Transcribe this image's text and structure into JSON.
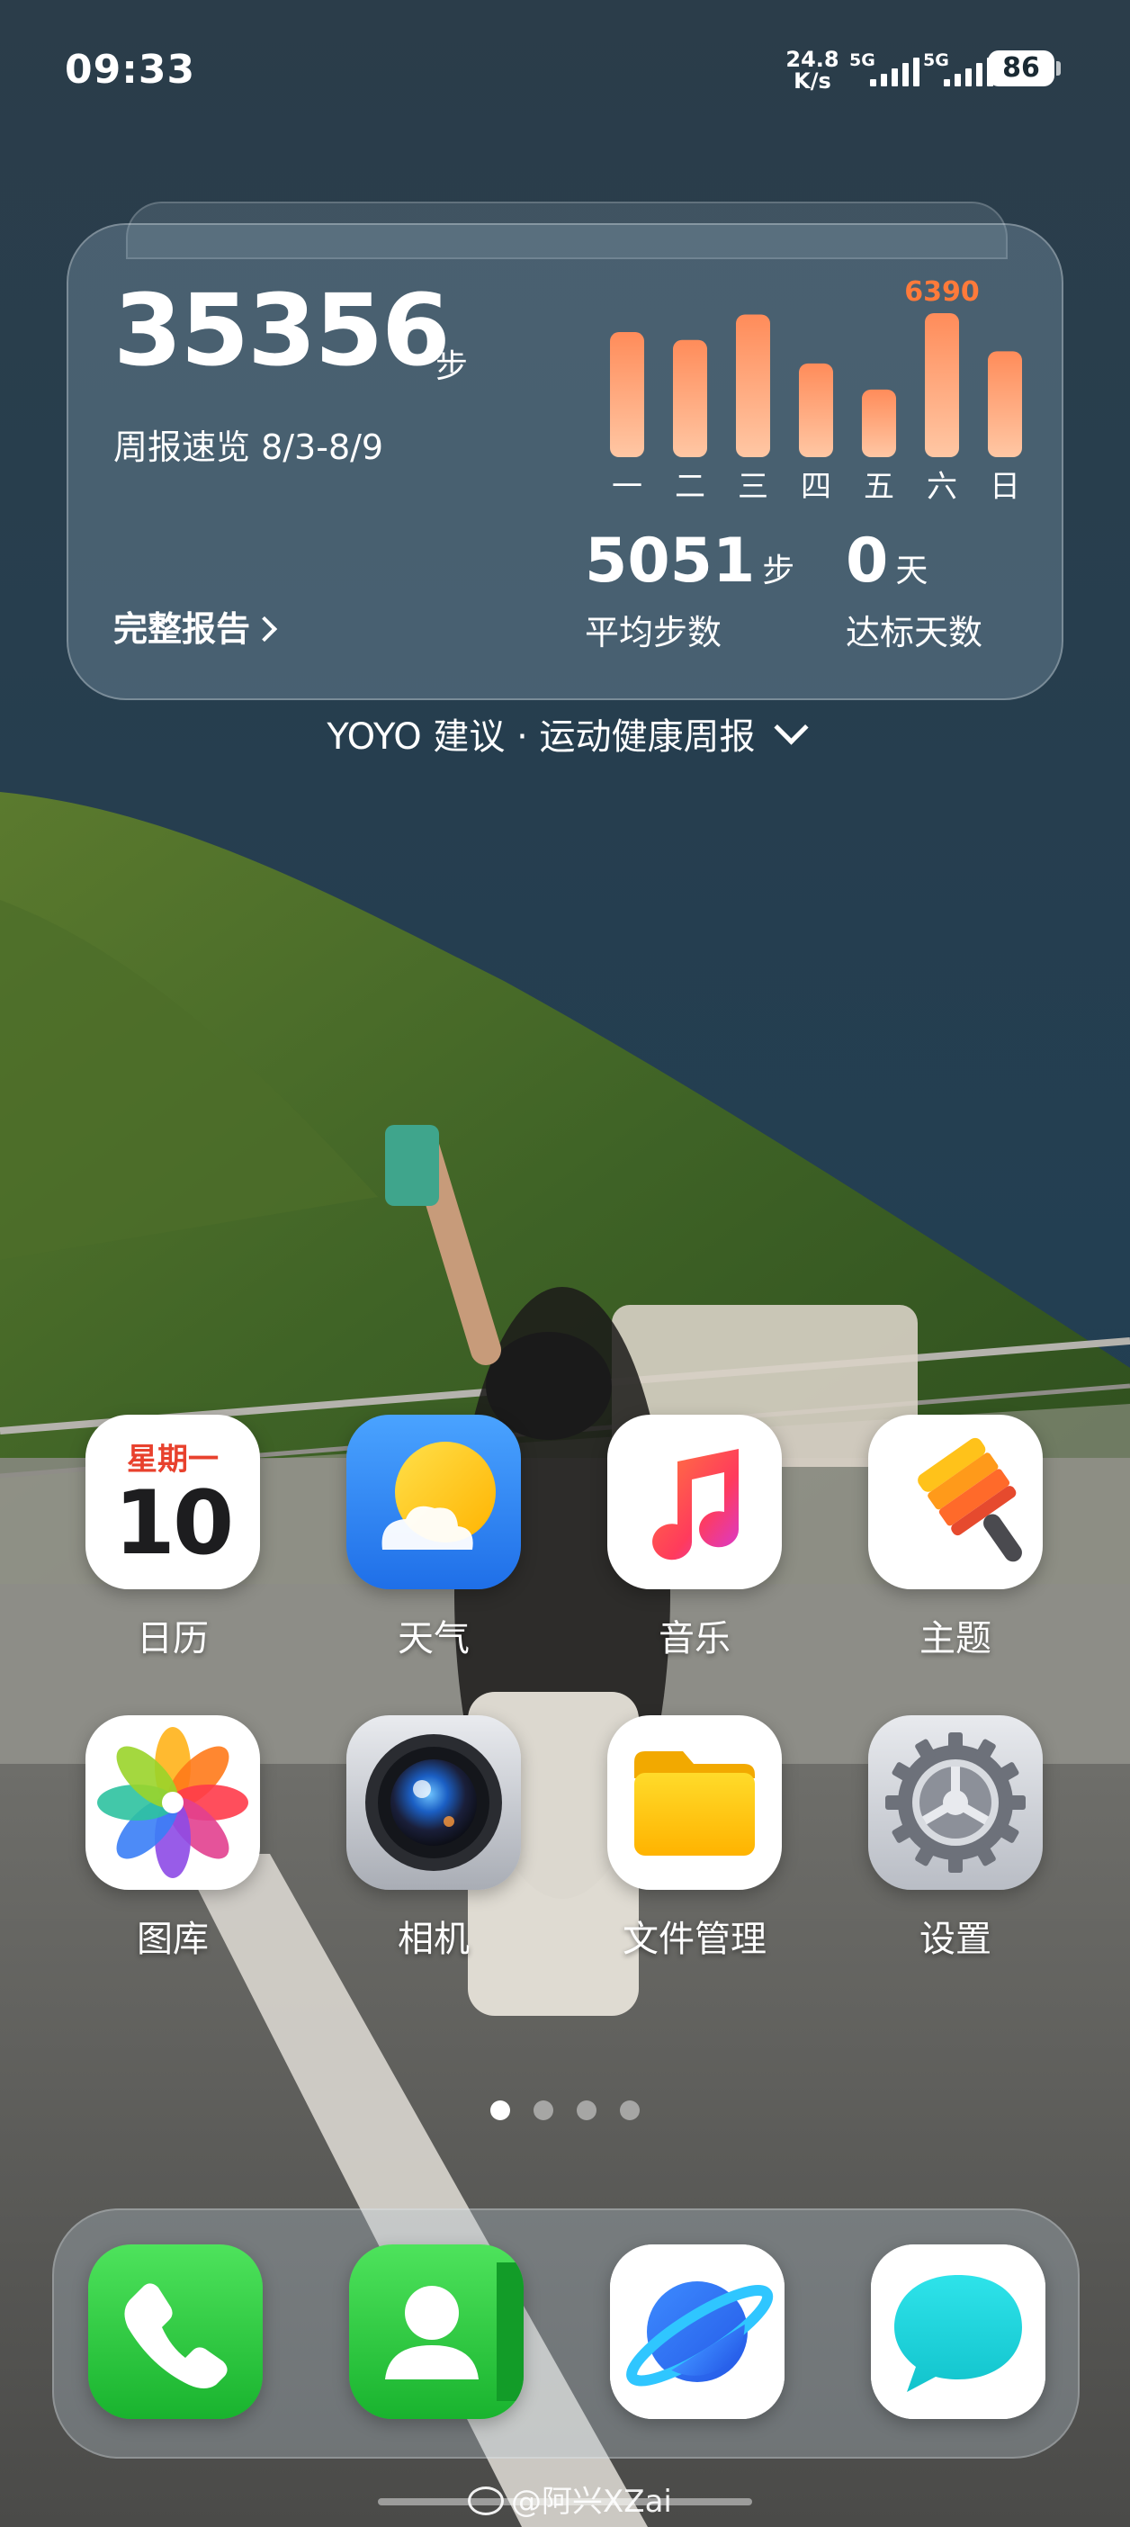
{
  "status_bar": {
    "time": "09:33",
    "net_speed_value": "24.8",
    "net_speed_unit": "K/s",
    "sim1_label": "5G",
    "sim2_label": "5G",
    "battery": "86"
  },
  "health_widget": {
    "total_steps": "35356",
    "steps_unit": "步",
    "week_title": "周报速览 8/3-8/9",
    "full_report_label": "完整报告",
    "avg_steps_value": "5051",
    "avg_steps_unit": "步",
    "avg_steps_label": "平均步数",
    "goal_days_value": "0",
    "goal_days_unit": "天",
    "goal_days_label": "达标天数",
    "chart_data": {
      "type": "bar",
      "categories": [
        "一",
        "二",
        "三",
        "四",
        "五",
        "六",
        "日"
      ],
      "values": [
        5550,
        5200,
        6330,
        4160,
        3000,
        6390,
        4700
      ],
      "highlight_label": "6390",
      "highlight_index": 5,
      "ylim": [
        0,
        6390
      ],
      "bar_gradient": [
        "#ffc7a4",
        "#ff8c5a"
      ],
      "highlight_color": "#ff7a3a",
      "grid": false
    }
  },
  "suggestion": {
    "text": "YOYO 建议 · 运动健康周报"
  },
  "apps": [
    {
      "label": "日历",
      "icon": "calendar-icon",
      "calendar_weekday": "星期一",
      "calendar_day": "10"
    },
    {
      "label": "天气",
      "icon": "weather-icon"
    },
    {
      "label": "音乐",
      "icon": "music-icon"
    },
    {
      "label": "主题",
      "icon": "theme-brush-icon"
    },
    {
      "label": "图库",
      "icon": "gallery-pinwheel-icon"
    },
    {
      "label": "相机",
      "icon": "camera-icon"
    },
    {
      "label": "文件管理",
      "icon": "folder-icon"
    },
    {
      "label": "设置",
      "icon": "gear-icon"
    }
  ],
  "page_indicator": {
    "count": 4,
    "active": 0
  },
  "dock": [
    {
      "icon": "phone-icon"
    },
    {
      "icon": "contacts-icon"
    },
    {
      "icon": "browser-planet-icon"
    },
    {
      "icon": "messages-icon"
    }
  ],
  "watermark": "@阿兴XZai",
  "colors": {
    "calendar_red": "#e8412d",
    "weather_blue": "#2f8cf6",
    "dock_green": "#23c93d"
  }
}
